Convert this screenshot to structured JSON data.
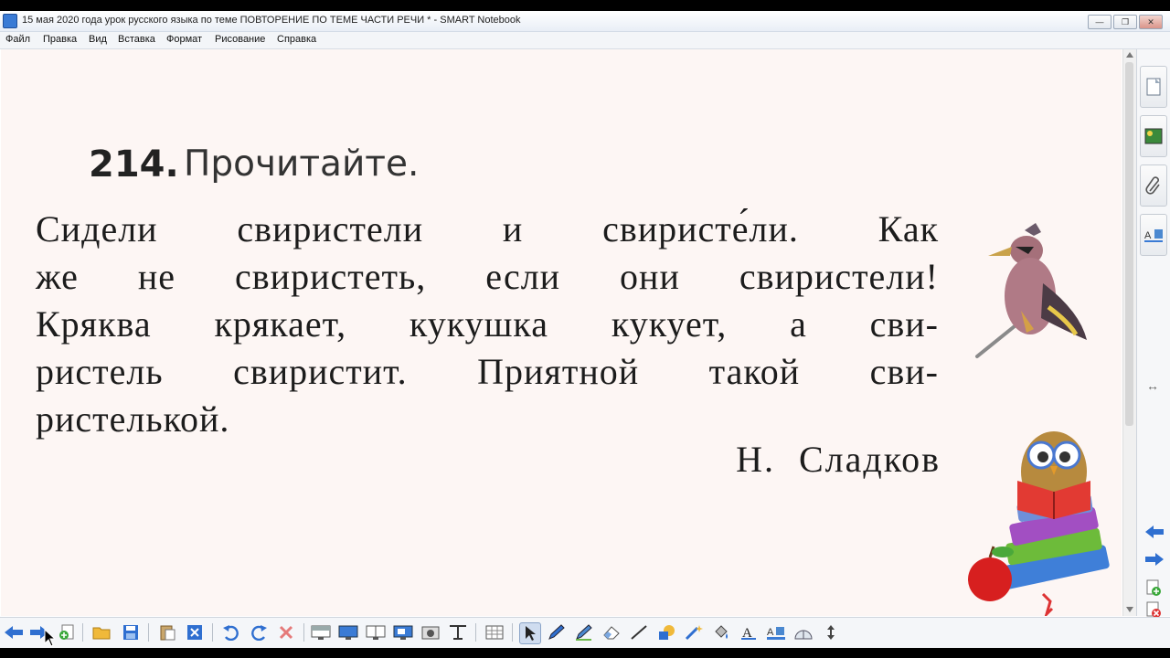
{
  "window": {
    "title": "15 мая 2020 года урок русского языка по теме ПОВТОРЕНИЕ ПО ТЕМЕ ЧАСТИ РЕЧИ * - SMART Notebook",
    "minimize": "—",
    "restore": "❐",
    "close": "✕"
  },
  "menu": [
    {
      "label": "Файл"
    },
    {
      "label": "Правка"
    },
    {
      "label": "Вид"
    },
    {
      "label": "Вставка"
    },
    {
      "label": "Формат"
    },
    {
      "label": "Рисование"
    },
    {
      "label": "Справка"
    }
  ],
  "page": {
    "exercise_number": "214.",
    "instruction": "Прочитайте.",
    "lines": [
      "Сидели свиристели и свиристе́ли. Как",
      "же не свиристеть, если они свиристели!",
      "Кряква крякает, кукушка кукует, а сви-",
      "ристель свиристит. Приятной такой сви-",
      "ристелькой."
    ],
    "author": "Н. Сладков"
  },
  "sidebar": {
    "expand_arrow": "↔"
  },
  "colors": {
    "canvas_bg": "#fdf6f4",
    "text": "#1c1c1c",
    "accent_blue": "#2f6fd0"
  }
}
